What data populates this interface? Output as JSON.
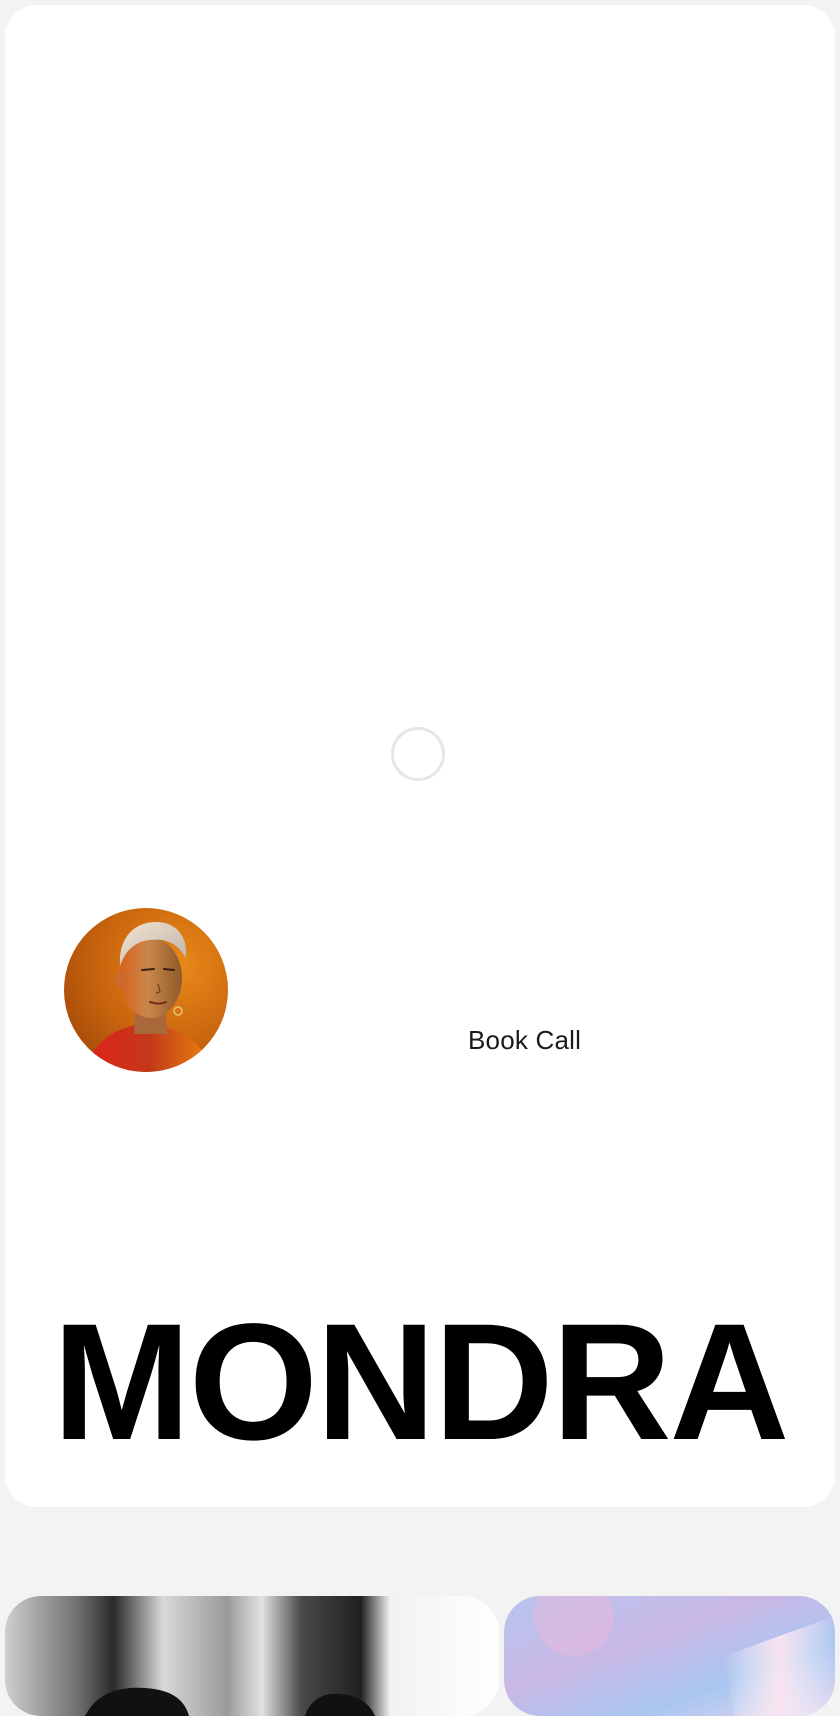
{
  "hero": {
    "book_call_label": "Book Call",
    "brand_name": "MONDRA"
  },
  "icons": {
    "loader": "loading-spinner-icon"
  },
  "colors": {
    "page_background": "#f3f3f3",
    "card_background": "#ffffff",
    "text": "#000000",
    "loader_ring": "#e6e6e6"
  }
}
